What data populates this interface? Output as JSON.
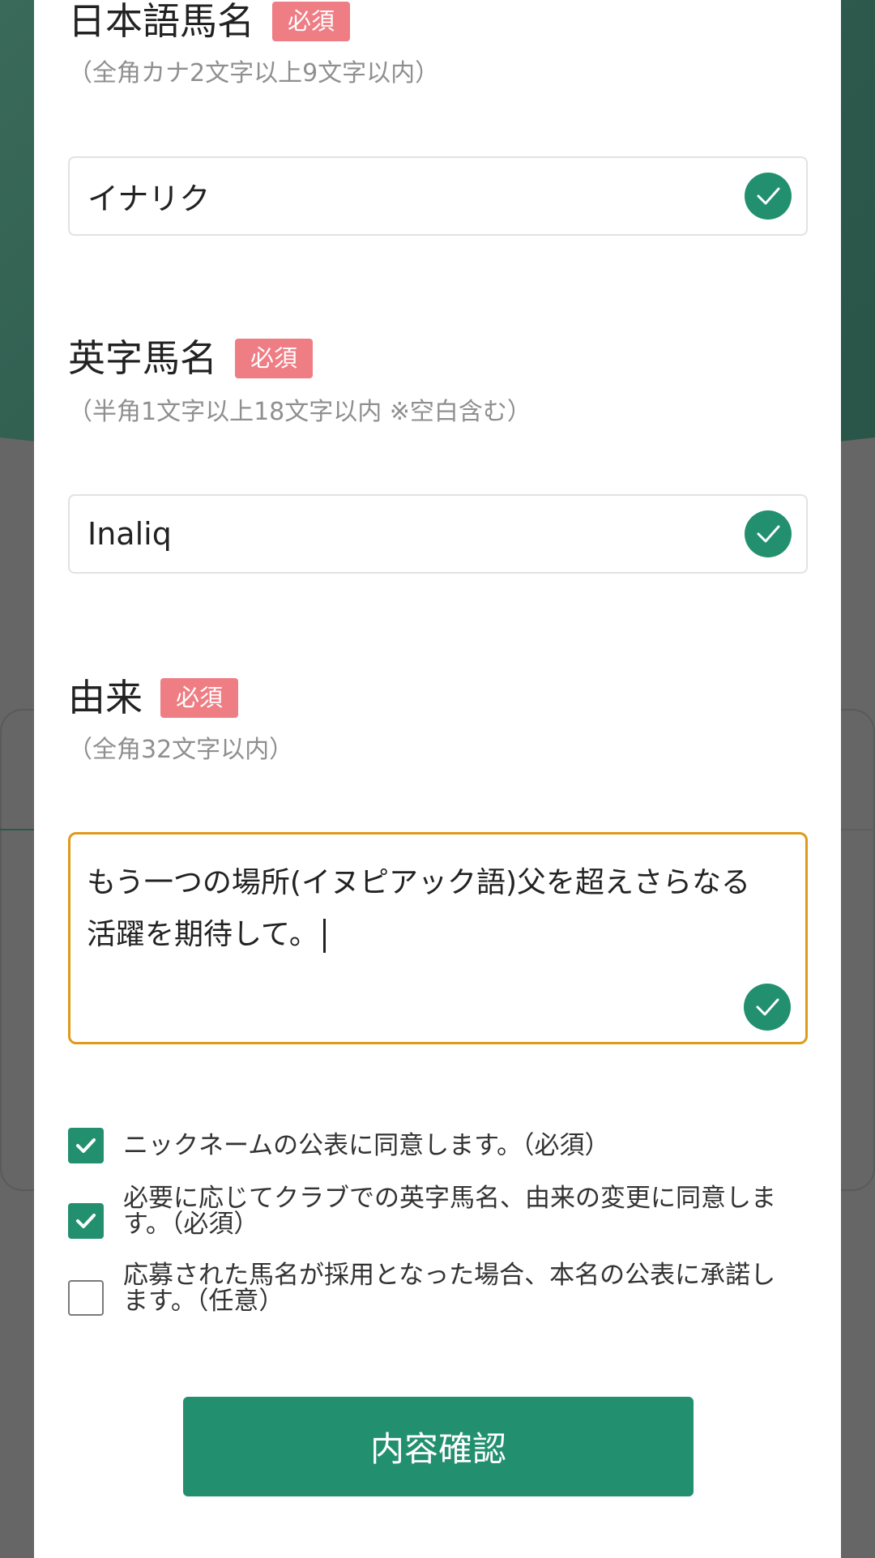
{
  "form": {
    "japanese_name": {
      "label": "日本語馬名",
      "required_badge": "必須",
      "hint": "（全角カナ2文字以上9文字以内）",
      "value": "イナリク",
      "valid_icon": "check-circle-icon"
    },
    "english_name": {
      "label": "英字馬名",
      "required_badge": "必須",
      "hint": "（半角1文字以上18文字以内 ※空白含む）",
      "value": "Inaliq",
      "valid_icon": "check-circle-icon"
    },
    "origin": {
      "label": "由来",
      "required_badge": "必須",
      "hint": "（全角32文字以内）",
      "value_line1": "もう一つの場所(イヌピアック語)父を超えさらなる",
      "value_line2": "活躍を期待して。",
      "valid_icon": "check-circle-icon"
    },
    "consents": [
      {
        "label": "ニックネームの公表に同意します。（必須）",
        "checked": true
      },
      {
        "label": "必要に応じてクラブでの英字馬名、由来の変更に同意します。（必須）",
        "checked": true
      },
      {
        "label": "応募された馬名が採用となった場合、本名の公表に承諾します。（任意）",
        "checked": false
      }
    ],
    "confirm_button": "内容確認"
  },
  "colors": {
    "accent_green": "#22906f",
    "required_badge": "#ef7d84",
    "focus_border": "#e09a1a",
    "overlay": "#666666"
  }
}
